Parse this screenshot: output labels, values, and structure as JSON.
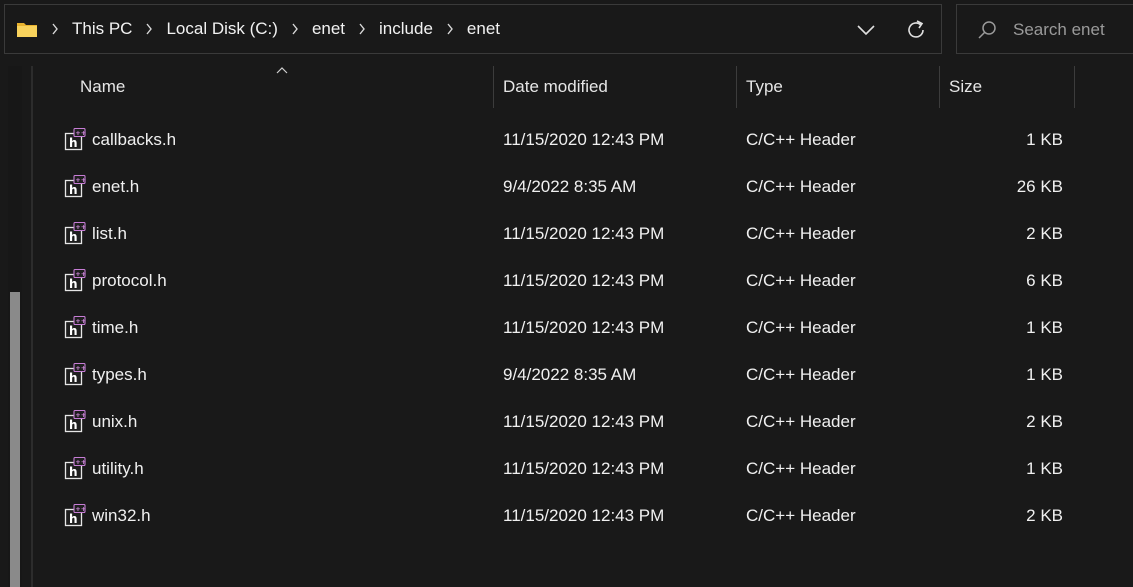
{
  "breadcrumb": {
    "items": [
      "This PC",
      "Local Disk (C:)",
      "enet",
      "include",
      "enet"
    ]
  },
  "search": {
    "placeholder": "Search enet"
  },
  "columns": {
    "name": "Name",
    "date": "Date modified",
    "type": "Type",
    "size": "Size"
  },
  "files": [
    {
      "name": "callbacks.h",
      "date": "11/15/2020 12:43 PM",
      "type": "C/C++ Header",
      "size": "1 KB"
    },
    {
      "name": "enet.h",
      "date": "9/4/2022 8:35 AM",
      "type": "C/C++ Header",
      "size": "26 KB"
    },
    {
      "name": "list.h",
      "date": "11/15/2020 12:43 PM",
      "type": "C/C++ Header",
      "size": "2 KB"
    },
    {
      "name": "protocol.h",
      "date": "11/15/2020 12:43 PM",
      "type": "C/C++ Header",
      "size": "6 KB"
    },
    {
      "name": "time.h",
      "date": "11/15/2020 12:43 PM",
      "type": "C/C++ Header",
      "size": "1 KB"
    },
    {
      "name": "types.h",
      "date": "9/4/2022 8:35 AM",
      "type": "C/C++ Header",
      "size": "1 KB"
    },
    {
      "name": "unix.h",
      "date": "11/15/2020 12:43 PM",
      "type": "C/C++ Header",
      "size": "2 KB"
    },
    {
      "name": "utility.h",
      "date": "11/15/2020 12:43 PM",
      "type": "C/C++ Header",
      "size": "1 KB"
    },
    {
      "name": "win32.h",
      "date": "11/15/2020 12:43 PM",
      "type": "C/C++ Header",
      "size": "2 KB"
    }
  ],
  "icons": {
    "folder": "folder-icon",
    "file": "cpp-header-file-icon",
    "search": "search-icon",
    "refresh": "refresh-icon",
    "dropdown": "chevron-down-icon"
  },
  "colors": {
    "background": "#191919",
    "folder": "#f4c64a",
    "file_badge": "#c77dd6",
    "border": "#3a3a3a"
  }
}
